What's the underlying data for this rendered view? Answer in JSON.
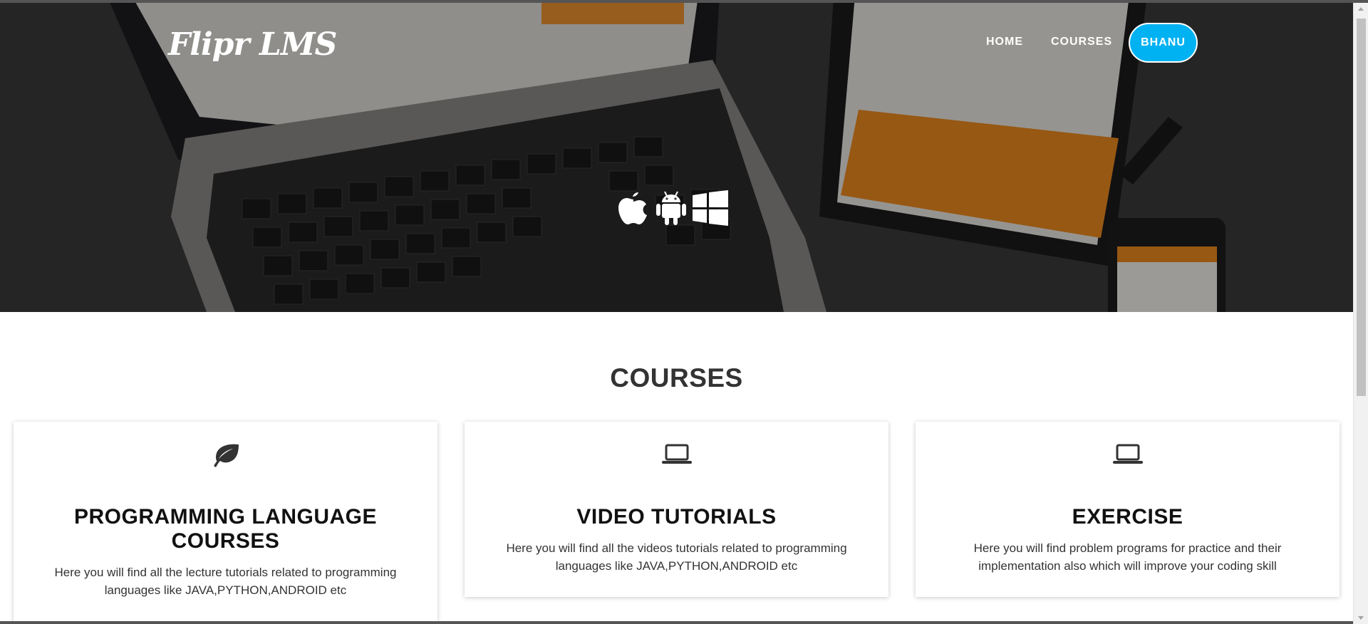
{
  "header": {
    "brand": "Flipr LMS",
    "nav": [
      {
        "label": "HOME"
      },
      {
        "label": "COURSES"
      }
    ],
    "user_button": "BHANU"
  },
  "hero": {
    "icons": [
      "apple-icon",
      "android-icon",
      "windows-icon"
    ]
  },
  "courses": {
    "title": "COURSES",
    "cards": [
      {
        "icon": "leaf-icon",
        "title": "PROGRAMMING LANGUAGE COURSES",
        "text": "Here you will find all the lecture tutorials related to programming languages like JAVA,PYTHON,ANDROID etc"
      },
      {
        "icon": "laptop-icon",
        "title": "VIDEO TUTORIALS",
        "text": "Here you will find all the videos tutorials related to programming languages like JAVA,PYTHON,ANDROID etc"
      },
      {
        "icon": "laptop-icon",
        "title": "EXERCISE",
        "text": "Here you will find problem programs for practice and their implementation also which will improve your coding skill"
      }
    ]
  },
  "colors": {
    "accent": "#00b2f2",
    "hero_bg": "#2e2d2e",
    "hero_orange": "#e8871e"
  }
}
